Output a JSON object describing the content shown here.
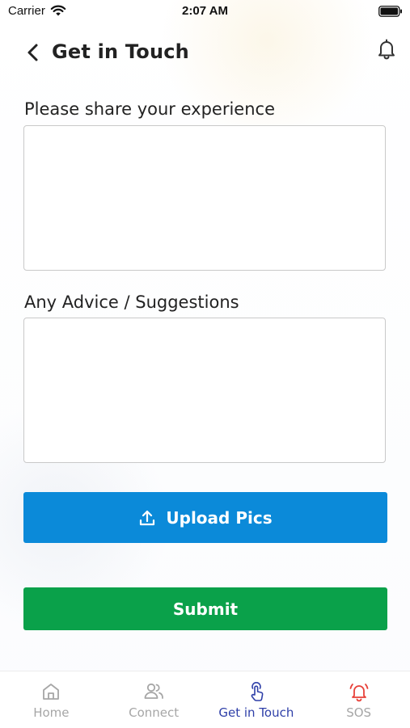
{
  "status_bar": {
    "carrier": "Carrier",
    "time": "2:07 AM"
  },
  "header": {
    "title": "Get in Touch",
    "back_icon": "chevron-left-icon",
    "notification_icon": "bell-icon"
  },
  "form": {
    "experience_label": "Please share your experience",
    "experience_value": "",
    "advice_label": "Any Advice / Suggestions",
    "advice_value": "",
    "upload_label": "Upload Pics",
    "upload_icon": "upload-icon",
    "submit_label": "Submit"
  },
  "tabs": [
    {
      "label": "Home",
      "icon": "home-icon",
      "active": false
    },
    {
      "label": "Connect",
      "icon": "users-icon",
      "active": false
    },
    {
      "label": "Get in Touch",
      "icon": "touch-hand-icon",
      "active": true
    },
    {
      "label": "SOS",
      "icon": "alarm-bell-icon",
      "active": false
    }
  ],
  "colors": {
    "upload_button": "#0b8ad9",
    "submit_button": "#0aa14a",
    "active_tab": "#2e3fa8",
    "inactive_tab": "#a6a6a6",
    "sos_icon": "#e8423a"
  }
}
